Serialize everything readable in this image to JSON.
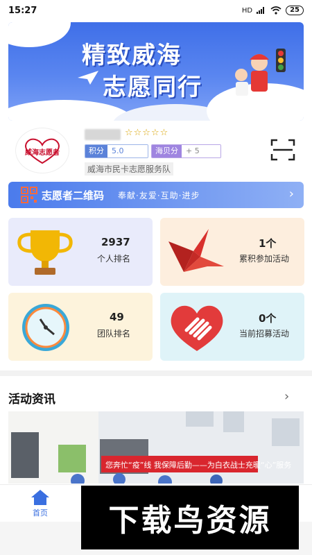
{
  "status": {
    "time": "15:27",
    "signal": "HD",
    "battery": "25"
  },
  "banner": {
    "line1": "精致威海",
    "line2": "志愿同行"
  },
  "profile": {
    "logo_text": "威海志愿者",
    "stars": "☆☆☆☆☆",
    "points_label": "积分",
    "points_value": "5.0",
    "haibei_label": "海贝分",
    "haibei_value": "+ 5",
    "organization": "威海市民卡志愿服务队"
  },
  "qr": {
    "label": "志愿者二维码",
    "slogan": "奉献·友爱·互助·进步"
  },
  "stats": [
    {
      "value": "2937",
      "label": "个人排名",
      "icon": "trophy-icon"
    },
    {
      "value": "1个",
      "label": "累积参加活动",
      "icon": "origami-crane-icon"
    },
    {
      "value": "49",
      "label": "团队排名",
      "icon": "clock-icon"
    },
    {
      "value": "0个",
      "label": "当前招募活动",
      "icon": "heart-hand-icon"
    }
  ],
  "news": {
    "title": "活动资讯",
    "photo_banner": "您奔忙“疫”线 我保障后勤——为白衣战士充暖“心”服务"
  },
  "tabbar": {
    "home_label": "首页"
  },
  "watermark": "下载鸟资源",
  "colors": {
    "accent": "#3a6fe0",
    "banner_blue": "#4b7bec",
    "trophy": "#f2b705",
    "crane": "#d8302d",
    "heart": "#e23b3b"
  }
}
